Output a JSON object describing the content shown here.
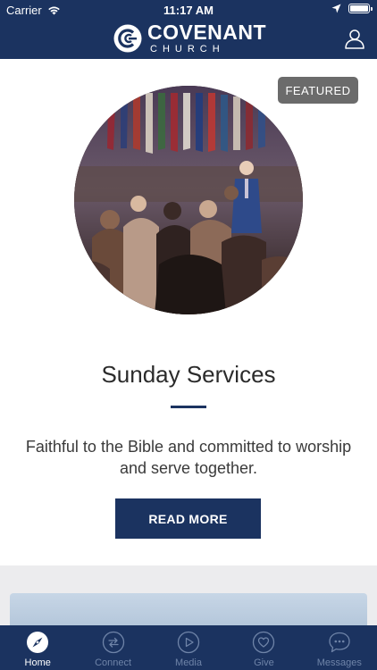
{
  "status_bar": {
    "carrier": "Carrier",
    "time": "11:17 AM"
  },
  "header": {
    "logo_title": "COVENANT",
    "logo_subtitle": "CHURCH"
  },
  "featured_card": {
    "badge": "FEATURED",
    "title": "Sunday Services",
    "description": "Faithful to the Bible and committed to worship and serve together.",
    "button_label": "READ MORE"
  },
  "tabs": [
    {
      "label": "Home",
      "icon": "compass-icon",
      "active": true
    },
    {
      "label": "Connect",
      "icon": "connect-arrows-icon",
      "active": false
    },
    {
      "label": "Media",
      "icon": "play-icon",
      "active": false
    },
    {
      "label": "Give",
      "icon": "heart-icon",
      "active": false
    },
    {
      "label": "Messages",
      "icon": "chat-bubble-icon",
      "active": false
    }
  ],
  "colors": {
    "brand_navy": "#1b3360",
    "badge_gray": "#6b6b6b",
    "inactive_tab": "#6f84a8"
  }
}
